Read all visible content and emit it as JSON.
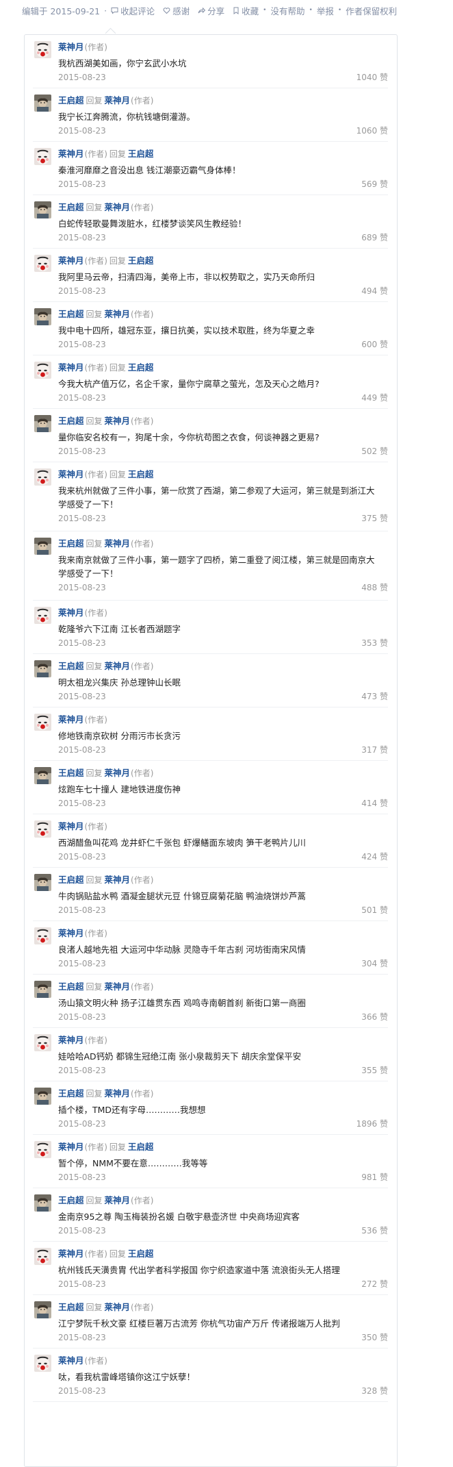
{
  "meta_bar": {
    "edited": "编辑于 2015-09-21",
    "collapse_comments": "收起评论",
    "thanks": "感谢",
    "share": "分享",
    "collect": "收藏",
    "no_help": "没有帮助",
    "report": "举报",
    "copyright": "作者保留权利"
  },
  "labels": {
    "reply": "回复",
    "author_tag": "(作者)",
    "vote_suffix": "赞"
  },
  "comments": [
    {
      "author": "莱神月",
      "author_tag": "(作者)",
      "reply_to": "",
      "reply_tag": "",
      "text": "我杭西湖美如画，你宁玄武小水坑",
      "date": "2015-08-23",
      "votes": "1040 赞",
      "avatar": "moon"
    },
    {
      "author": "王启超",
      "author_tag": "",
      "reply_to": "莱神月",
      "reply_tag": "(作者)",
      "text": "我宁长江奔腾流，你杭钱塘倒灌游。",
      "date": "2015-08-23",
      "votes": "1060 赞",
      "avatar": "wang"
    },
    {
      "author": "莱神月",
      "author_tag": "(作者)",
      "reply_to": "王启超",
      "reply_tag": "",
      "text": "秦淮河靡靡之音没出息 钱江潮豪迈霸气身体棒！",
      "date": "2015-08-23",
      "votes": "569 赞",
      "avatar": "moon"
    },
    {
      "author": "王启超",
      "author_tag": "",
      "reply_to": "莱神月",
      "reply_tag": "(作者)",
      "text": "白蛇传轻歌曼舞泼脏水，红楼梦谈笑风生教经验！",
      "date": "2015-08-23",
      "votes": "689 赞",
      "avatar": "wang"
    },
    {
      "author": "莱神月",
      "author_tag": "(作者)",
      "reply_to": "王启超",
      "reply_tag": "",
      "text": "我阿里马云帝，扫清四海，美帝上市，非以权势取之，实乃天命所归",
      "date": "2015-08-23",
      "votes": "494 赞",
      "avatar": "moon"
    },
    {
      "author": "王启超",
      "author_tag": "",
      "reply_to": "莱神月",
      "reply_tag": "(作者)",
      "text": "我中电十四所，雄冠东亚，攘日抗美，实以技术取胜，终为华夏之幸",
      "date": "2015-08-23",
      "votes": "600 赞",
      "avatar": "wang"
    },
    {
      "author": "莱神月",
      "author_tag": "(作者)",
      "reply_to": "王启超",
      "reply_tag": "",
      "text": "今我大杭产值万亿，名企千家，量你宁腐草之萤光，怎及天心之皓月?",
      "date": "2015-08-23",
      "votes": "449 赞",
      "avatar": "moon"
    },
    {
      "author": "王启超",
      "author_tag": "",
      "reply_to": "莱神月",
      "reply_tag": "(作者)",
      "text": "量你临安名校有一，狗尾十余，今你杭苟图之衣食，何谈神器之更易?",
      "date": "2015-08-23",
      "votes": "502 赞",
      "avatar": "wang"
    },
    {
      "author": "莱神月",
      "author_tag": "(作者)",
      "reply_to": "王启超",
      "reply_tag": "",
      "text": "我来杭州就做了三件小事，第一欣赏了西湖，第二参观了大运河，第三就是到浙江大学感受了一下！",
      "date": "2015-08-23",
      "votes": "375 赞",
      "avatar": "moon"
    },
    {
      "author": "王启超",
      "author_tag": "",
      "reply_to": "莱神月",
      "reply_tag": "(作者)",
      "text": "我来南京就做了三件小事，第一题字了四桥，第二重登了阅江楼，第三就是回南京大学感受了一下！",
      "date": "2015-08-23",
      "votes": "488 赞",
      "avatar": "wang"
    },
    {
      "author": "莱神月",
      "author_tag": "(作者)",
      "reply_to": "",
      "reply_tag": "",
      "text": "乾隆爷六下江南 江长者西湖题字",
      "date": "2015-08-23",
      "votes": "353 赞",
      "avatar": "moon"
    },
    {
      "author": "王启超",
      "author_tag": "",
      "reply_to": "莱神月",
      "reply_tag": "(作者)",
      "text": "明太祖龙兴集庆 孙总理钟山长眠",
      "date": "2015-08-23",
      "votes": "473 赞",
      "avatar": "wang"
    },
    {
      "author": "莱神月",
      "author_tag": "(作者)",
      "reply_to": "",
      "reply_tag": "",
      "text": "修地铁南京砍树 分雨污市长贪污",
      "date": "2015-08-23",
      "votes": "317 赞",
      "avatar": "moon"
    },
    {
      "author": "王启超",
      "author_tag": "",
      "reply_to": "莱神月",
      "reply_tag": "(作者)",
      "text": "炫跑车七十撞人 建地铁进度伤神",
      "date": "2015-08-23",
      "votes": "414 赞",
      "avatar": "wang"
    },
    {
      "author": "莱神月",
      "author_tag": "(作者)",
      "reply_to": "",
      "reply_tag": "",
      "text": "西湖醋鱼叫花鸡 龙井虾仁千张包 虾爆鳝面东坡肉 笋干老鸭片儿川",
      "date": "2015-08-23",
      "votes": "424 赞",
      "avatar": "moon"
    },
    {
      "author": "王启超",
      "author_tag": "",
      "reply_to": "莱神月",
      "reply_tag": "(作者)",
      "text": "牛肉锅贴盐水鸭 酒凝金腿状元豆 什锦豆腐菊花脑 鸭油烧饼炒芦蒿",
      "date": "2015-08-23",
      "votes": "501 赞",
      "avatar": "wang"
    },
    {
      "author": "莱神月",
      "author_tag": "(作者)",
      "reply_to": "",
      "reply_tag": "",
      "text": "良渚人越地先祖 大运河中华动脉 灵隐寺千年古刹 河坊街南宋风情",
      "date": "2015-08-23",
      "votes": "304 赞",
      "avatar": "moon"
    },
    {
      "author": "王启超",
      "author_tag": "",
      "reply_to": "莱神月",
      "reply_tag": "(作者)",
      "text": "汤山猿文明火种 扬子江雄贯东西 鸡鸣寺南朝首刹 新街口第一商圈",
      "date": "2015-08-23",
      "votes": "366 赞",
      "avatar": "wang"
    },
    {
      "author": "莱神月",
      "author_tag": "(作者)",
      "reply_to": "",
      "reply_tag": "",
      "text": "娃哈哈AD钙奶 都锦生冠绝江南 张小泉裁剪天下 胡庆余堂保平安",
      "date": "2015-08-23",
      "votes": "355 赞",
      "avatar": "moon"
    },
    {
      "author": "王启超",
      "author_tag": "",
      "reply_to": "莱神月",
      "reply_tag": "(作者)",
      "text": "插个楼，TMD还有字母…………我想想",
      "date": "2015-08-23",
      "votes": "1896 赞",
      "avatar": "wang"
    },
    {
      "author": "莱神月",
      "author_tag": "(作者)",
      "reply_to": "王启超",
      "reply_tag": "",
      "text": "暂个停，NMM不要在意…………我等等",
      "date": "2015-08-23",
      "votes": "981 赞",
      "avatar": "moon"
    },
    {
      "author": "王启超",
      "author_tag": "",
      "reply_to": "莱神月",
      "reply_tag": "(作者)",
      "text": "金南京95之尊 陶玉梅装扮名媛 白敬宇悬壶济世 中央商场迎宾客",
      "date": "2015-08-23",
      "votes": "536 赞",
      "avatar": "wang"
    },
    {
      "author": "莱神月",
      "author_tag": "(作者)",
      "reply_to": "王启超",
      "reply_tag": "",
      "text": "杭州钱氏天潢贵胄 代出学者科学报国 你宁织造家道中落 流浪街头无人搭理",
      "date": "2015-08-23",
      "votes": "272 赞",
      "avatar": "moon"
    },
    {
      "author": "王启超",
      "author_tag": "",
      "reply_to": "莱神月",
      "reply_tag": "(作者)",
      "text": "江宁梦阮千秋文豪 红楼巨著万古流芳 你杭气功宙产万斤 传诸报端万人批判",
      "date": "2015-08-23",
      "votes": "350 赞",
      "avatar": "wang"
    },
    {
      "author": "莱神月",
      "author_tag": "(作者)",
      "reply_to": "",
      "reply_tag": "",
      "text": "呔，看我杭雷峰塔镇你这江宁妖孽！",
      "date": "2015-08-23",
      "votes": "328 赞",
      "avatar": "moon"
    }
  ]
}
